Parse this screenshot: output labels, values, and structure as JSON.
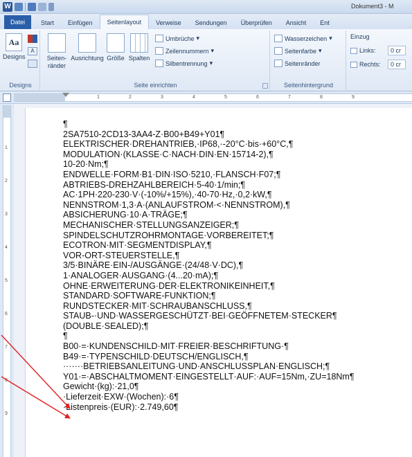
{
  "titlebar": {
    "title": "Dokument3 - M"
  },
  "tabs": [
    "Datei",
    "Start",
    "Einfügen",
    "Seitenlayout",
    "Verweise",
    "Sendungen",
    "Überprüfen",
    "Ansicht",
    "Ent"
  ],
  "ribbon": {
    "designs": {
      "button": "Designs",
      "group_label": "Designs"
    },
    "page_setup": {
      "margins": "Seiten-\nränder",
      "orientation": "Ausrichtung",
      "size": "Größe",
      "columns": "Spalten",
      "breaks": "Umbrüche",
      "line_numbers": "Zeilennummern",
      "hyphenation": "Silbentrennung",
      "group_label": "Seite einrichten"
    },
    "page_background": {
      "watermark": "Wasserzeichen",
      "page_color": "Seitenfarbe",
      "page_borders": "Seitenränder",
      "group_label": "Seitenhintergrund"
    },
    "indent": {
      "label": "Einzug",
      "left_label": "Links:",
      "left_value": "0 cr",
      "right_label": "Rechts:",
      "right_value": "0 cr"
    }
  },
  "ruler": {
    "ticks": [
      "1",
      "2",
      "3",
      "4",
      "5",
      "6",
      "7",
      "8",
      "9"
    ]
  },
  "vruler": {
    "ticks": [
      "1",
      "2",
      "3",
      "4",
      "5",
      "6",
      "7",
      "8",
      "9"
    ]
  },
  "document": {
    "lines": [
      "¶",
      "2SA7510-2CD13-3AA4-Z·B00+B49+Y01¶",
      "ELEKTRISCHER·DREHANTRIEB,·IP68,·-20°C·bis·+60°C,¶",
      "MODULATION·(KLASSE·C·NACH·DIN·EN·15714-2),¶",
      "10-20·Nm;¶",
      "ENDWELLE·FORM·B1·DIN·ISO·5210,·FLANSCH·F07;¶",
      "ABTRIEBS-DREHZAHLBEREICH·5-40·1/min;¶",
      "AC·1PH·220-230·V·(-10%/+15%),·40-70·Hz,·0,2·kW,¶",
      "NENNSTROM·1,3·A·(ANLAUFSTROM·<·NENNSTROM),¶",
      "ABSICHERUNG·10·A·TRÄGE;¶",
      "MECHANISCHER·STELLUNGSANZEIGER;¶",
      "SPINDELSCHUTZROHRMONTAGE·VORBEREITET;¶",
      "ECOTRON·MIT·SEGMENTDISPLAY,¶",
      "VOR-ORT-STEUERSTELLE,¶",
      "3/5·BINÄRE·EIN-/AUSGÄNGE·(24/48·V·DC),¶",
      "1·ANALOGER·AUSGANG·(4...20·mA);¶",
      "OHNE·ERWEITERUNG·DER·ELEKTRONIKEINHEIT,¶",
      "STANDARD·SOFTWARE-FUNKTION;¶",
      "RUNDSTECKER·MIT·SCHRAUBANSCHLUSS,¶",
      "STAUB-·UND·WASSERGESCHÜTZT·BEI·GEÖFFNETEM·STECKER¶",
      "(DOUBLE·SEALED);¶",
      "¶",
      "B00·=·KUNDENSCHILD·MIT·FREIER·BESCHRIFTUNG·¶",
      "B49·=·TYPENSCHILD·DEUTSCH/ENGLISCH,¶",
      "·······BETRIEBSANLEITUNG·UND·ANSCHLUSSPLAN·ENGLISCH;¶",
      "Y01·=·ABSCHALTMOMENT·EINGESTELLT·AUF:·AUF=15Nm,·ZU=18Nm¶",
      "Gewicht·(kg):·21,0¶",
      "·Lieferzeit·EXW·(Wochen):·6¶",
      "·Listenpreis·(EUR):·2.749,60¶"
    ]
  },
  "colors": {
    "annotation_arrow": "#e02020",
    "file_tab": "#2a5ea8"
  }
}
